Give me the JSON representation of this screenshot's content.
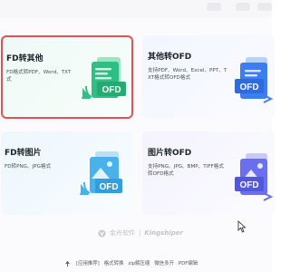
{
  "cards": [
    {
      "title": "FD转其他",
      "desc_line1": "FD格式转PDF、Word、TXT",
      "desc_line2": "式",
      "badge": "OFD",
      "accent": "#2db87d",
      "bg": "#e9f8f1",
      "selected": true,
      "icon": "ofd-to-document-icon"
    },
    {
      "title": "其他转OFD",
      "desc_line1": "支持PDF、Word、Excel、PPT、T",
      "desc_line2": "XT格式转OFD格式",
      "badge": "OFD",
      "accent": "#3c7df1",
      "bg": "#eef4ff",
      "selected": false,
      "icon": "document-to-ofd-icon"
    },
    {
      "title": "FD转图片",
      "desc_line1": "FD转PNG、JPG格式",
      "desc_line2": "",
      "badge": "OFD",
      "accent": "#3aa7e6",
      "bg": "#eaf6fd",
      "selected": false,
      "icon": "ofd-to-image-icon"
    },
    {
      "title": "图片转OFD",
      "desc_line1": "支持PNG、JPG、BMP、TIFF格式",
      "desc_line2": "转OFD格式",
      "badge": "OFD",
      "accent": "#5d63e6",
      "bg": "#f1f0ff",
      "selected": false,
      "icon": "image-to-ofd-icon"
    }
  ],
  "brand": {
    "name": "金舟软件",
    "separator": "|",
    "latin": "Kingshiper"
  },
  "footer": {
    "links": [
      "[应用推荐]",
      "格式转换",
      "zip解压缩",
      "微信多开",
      "PDF编辑"
    ]
  }
}
